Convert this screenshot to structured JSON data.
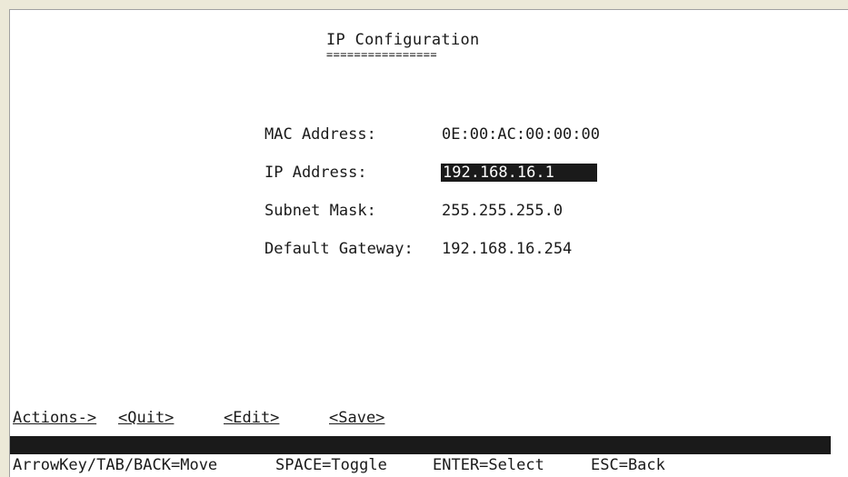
{
  "screen": {
    "title": "IP Configuration",
    "title_underline": "================"
  },
  "fields": [
    {
      "label": "MAC Address:",
      "value": "0E:00:AC:00:00:00"
    },
    {
      "label": "IP Address:",
      "value": "192.168.16.1"
    },
    {
      "label": "Subnet Mask:",
      "value": "255.255.255.0"
    },
    {
      "label": "Default Gateway:",
      "value": "192.168.16.254"
    }
  ],
  "actions": {
    "label": "Actions->",
    "quit": "<Quit>",
    "edit": "<Edit>",
    "save": "<Save>"
  },
  "help": {
    "move": "ArrowKey/TAB/BACK=Move",
    "toggle": "SPACE=Toggle",
    "select": "ENTER=Select",
    "back": "ESC=Back"
  },
  "colors": {
    "background": "#ffffff",
    "text": "#1a1a1a",
    "highlight_bg": "#1a1a1a",
    "highlight_text": "#ffffff",
    "frame": "#ece9d8"
  }
}
